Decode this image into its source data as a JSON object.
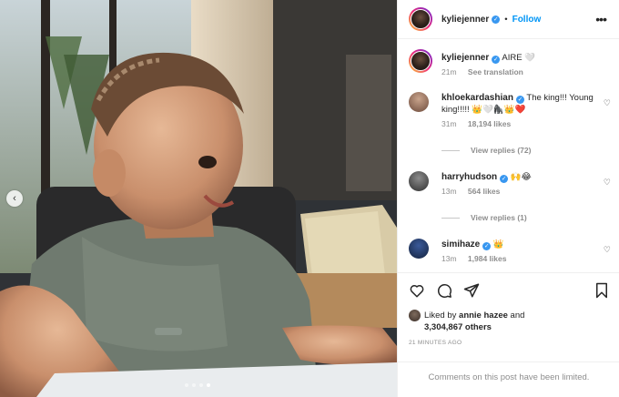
{
  "post": {
    "author": "kyliejenner",
    "follow_label": "Follow",
    "separator": "•",
    "more_icon": "more-horizontal-icon",
    "caption": "AIRE 🤍",
    "caption_time": "21m",
    "see_translation": "See translation"
  },
  "photo": {
    "carousel_pages": 4,
    "active_page": 3
  },
  "comments": [
    {
      "username": "khloekardashian",
      "verified": true,
      "text": "The king!!! Young king!!!!! 👑🤍🦍👑❤️",
      "time": "31m",
      "likes": "18,194 likes",
      "view_replies": "View replies (72)"
    },
    {
      "username": "harryhudson",
      "verified": true,
      "text": "🙌😂",
      "time": "13m",
      "likes": "564 likes",
      "view_replies": "View replies (1)"
    },
    {
      "username": "simihaze",
      "verified": true,
      "text": "👑",
      "time": "13m",
      "likes": "1,984 likes"
    }
  ],
  "engagement": {
    "liked_by_prefix": "Liked by ",
    "liked_by_user": "annie hazee",
    "liked_by_connector": " and",
    "others": "3,304,867 others",
    "posted_ago": "21 MINUTES AGO",
    "comments_limited": "Comments on this post have been limited."
  },
  "colors": {
    "accent": "#0095f6",
    "verified": "#3897f0",
    "secondary_text": "#8e8e8e"
  }
}
